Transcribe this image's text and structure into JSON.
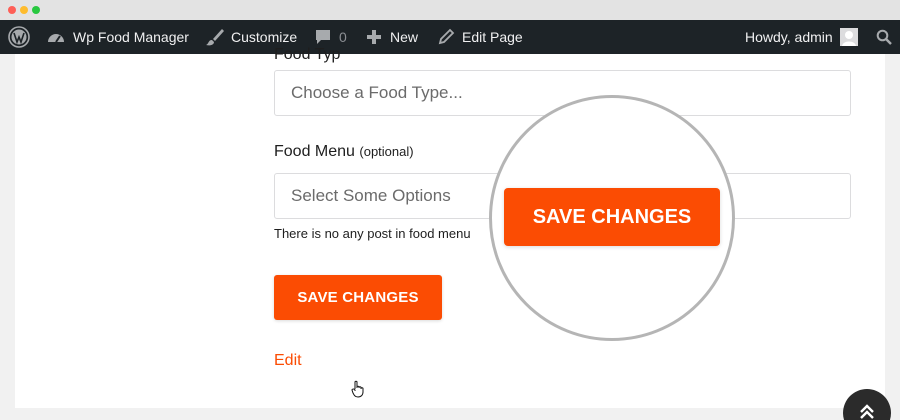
{
  "admin_bar": {
    "site_name": "Wp Food Manager",
    "customize": "Customize",
    "comments_count": "0",
    "new": "New",
    "edit_page": "Edit Page",
    "greeting": "Howdy, admin"
  },
  "form": {
    "type_label_partial": "Food Typ",
    "type_placeholder": "Choose a Food Type...",
    "menu_label": "Food Menu",
    "menu_optional": "(optional)",
    "menu_placeholder": "Select Some Options",
    "menu_help": "There is no any post in food menu",
    "save_label": "SAVE CHANGES",
    "edit_label": "Edit"
  },
  "zoom": {
    "save_label": "SAVE CHANGES"
  },
  "colors": {
    "accent": "#fb4c03",
    "admin_bar": "#1d2327"
  },
  "icons": [
    "wordpress-icon",
    "dashboard-icon",
    "paintbrush-icon",
    "comment-icon",
    "plus-icon",
    "pencil-icon",
    "avatar",
    "search-icon",
    "hand-cursor-icon",
    "double-chevron-up-icon"
  ]
}
